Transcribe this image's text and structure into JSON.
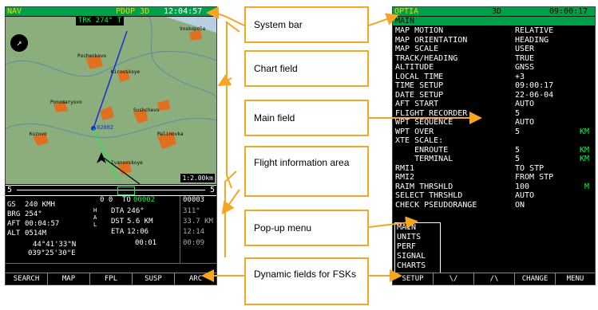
{
  "left": {
    "sys": {
      "mode": "NAV",
      "gps": "PDOP 3D",
      "time": "12:04:57"
    },
    "trk": "TRK 274° T",
    "scale": "1:2.00km",
    "cdi": {
      "left": "5",
      "right": "5"
    },
    "map_labels": [
      "Voskopole",
      "Pochenkovo",
      "Kirovskoye",
      "Demidov",
      "Ponomaryovo",
      "Sushchevo",
      "Novoye",
      "Pokrovka",
      "Kuzovo",
      "Tikhonovo",
      "Malinovka",
      "Korolevka",
      "Ivanovskoye"
    ],
    "wpt": "02002",
    "fia": {
      "col1": [
        {
          "k": "GS",
          "v": "240 KMH"
        },
        {
          "k": "BRG",
          "v": "254°"
        },
        {
          "k": "AFT",
          "v": "00:04:57"
        },
        {
          "k": "ALT",
          "v": "0514M"
        }
      ],
      "coord_lat": "44°41'33\"N",
      "coord_lon": "039°25'30\"E",
      "hdr_left": "0 0",
      "hdr_to": "TO",
      "hdr_wpt": "00002",
      "hdr_next": "00003",
      "side_letters": "H A L",
      "col2": [
        {
          "k": "DTA",
          "v": "246°",
          "n": "311°"
        },
        {
          "k": "DST",
          "v": "5.6 KM",
          "n": "33.7 KM"
        },
        {
          "k": "ETA",
          "v": "12:06",
          "n": "12:14"
        },
        {
          "k": "",
          "v": "00:01",
          "n": "00:09"
        }
      ]
    },
    "fsk": [
      "SEARCH",
      "MAP",
      "FPL",
      "SUSP",
      "ARC"
    ]
  },
  "right": {
    "sys": {
      "mode": "OPTIA",
      "gps": "3D",
      "time": "09:00:17"
    },
    "title": "MAIN",
    "rows": [
      {
        "k": "MAP MOTION",
        "v": "RELATIVE",
        "u": ""
      },
      {
        "k": "MAP ORIENTATION",
        "v": "HEADING",
        "u": ""
      },
      {
        "k": "MAP SCALE",
        "v": "USER",
        "u": ""
      },
      {
        "k": "TRACK/HEADING",
        "v": "TRUE",
        "u": ""
      },
      {
        "k": "ALTITUDE",
        "v": "GNSS",
        "u": ""
      },
      {
        "k": "LOCAL TIME",
        "v": "+3",
        "u": ""
      },
      {
        "k": "TIME SETUP",
        "v": "09:00:17",
        "u": ""
      },
      {
        "k": "DATE SETUP",
        "v": "22-06-04",
        "u": ""
      },
      {
        "k": "AFT START",
        "v": "AUTO",
        "u": ""
      },
      {
        "k": "FLIGHT RECORDER",
        "v": "5",
        "u": ""
      },
      {
        "k": "WPT SEQUENCE",
        "v": "AUTO",
        "u": ""
      },
      {
        "k": "WPT OVER",
        "v": "5",
        "u": "KM"
      },
      {
        "k": "XTE SCALE:",
        "v": "",
        "u": ""
      },
      {
        "k": "    ENROUTE",
        "v": "5",
        "u": "KM"
      },
      {
        "k": "    TERMINAL",
        "v": "5",
        "u": "KM"
      },
      {
        "k": "RMI1",
        "v": "TO STP",
        "u": ""
      },
      {
        "k": "RMI2",
        "v": "FROM STP",
        "u": ""
      },
      {
        "k": "RAIM THRSHLD",
        "v": "100",
        "u": "M"
      },
      {
        "k": "SELECT THRSHLD",
        "v": "AUTO",
        "u": ""
      },
      {
        "k": "CHECK PSEUDORANGE",
        "v": "ON",
        "u": ""
      }
    ],
    "popup": [
      "MAIN",
      "UNITS",
      "PERF",
      "SIGNAL",
      "CHARTS"
    ],
    "fsk": [
      "SETUP",
      "\\/",
      "/\\",
      "CHANGE",
      "MENU"
    ]
  },
  "callouts": {
    "system_bar": "System bar",
    "chart_field": "Chart field",
    "main_field": "Main field",
    "fia": "Flight information area",
    "popup": "Pop-up menu",
    "fsk": "Dynamic fields for FSKs"
  },
  "colors": {
    "callout_border": "#f5a623",
    "sys_bar": "#00a04a",
    "map": "#8cae7c",
    "route": "#1a2bd6"
  }
}
